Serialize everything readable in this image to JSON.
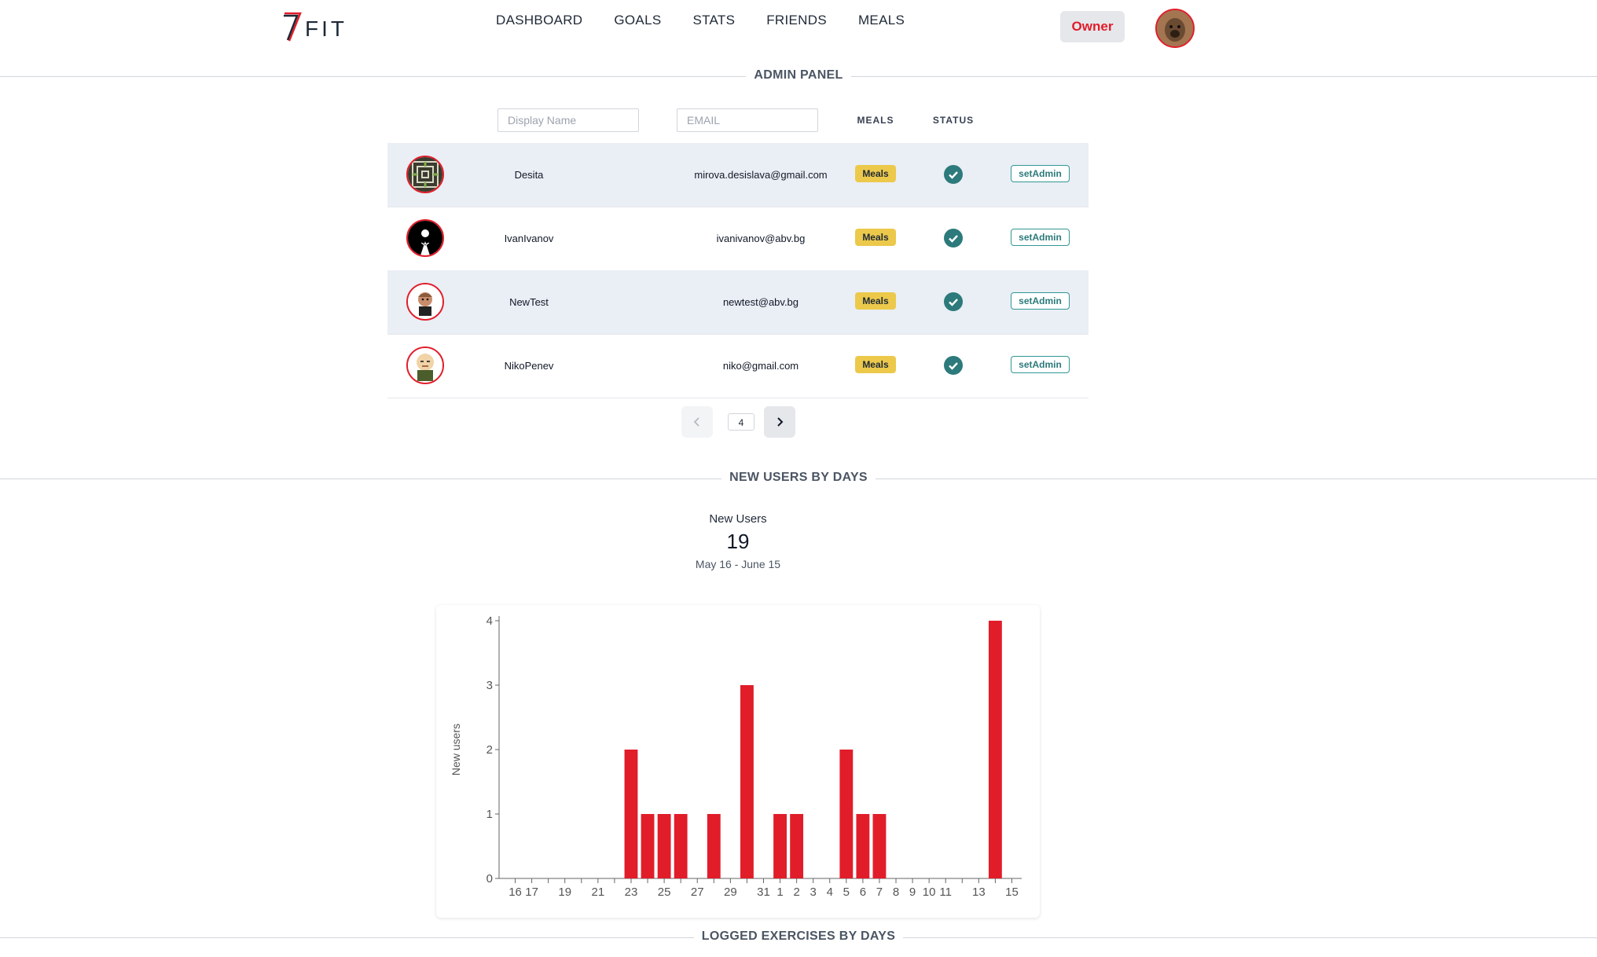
{
  "header": {
    "logo_text": "FIT",
    "nav": [
      "DASHBOARD",
      "GOALS",
      "STATS",
      "FRIENDS",
      "MEALS"
    ],
    "owner_label": "Owner"
  },
  "admin_panel": {
    "title": "ADMIN PANEL",
    "filters": {
      "display_name_placeholder": "Display Name",
      "email_placeholder": "EMAIL"
    },
    "columns": {
      "meals": "MEALS",
      "status": "STATUS"
    },
    "rows": [
      {
        "display_name": "Desita",
        "email": "mirova.desislava@gmail.com",
        "meals_label": "Meals",
        "status": "active",
        "action_label": "setAdmin"
      },
      {
        "display_name": "IvanIvanov",
        "email": "ivanivanov@abv.bg",
        "meals_label": "Meals",
        "status": "active",
        "action_label": "setAdmin"
      },
      {
        "display_name": "NewTest",
        "email": "newtest@abv.bg",
        "meals_label": "Meals",
        "status": "active",
        "action_label": "setAdmin"
      },
      {
        "display_name": "NikoPenev",
        "email": "niko@gmail.com",
        "meals_label": "Meals",
        "status": "active",
        "action_label": "setAdmin"
      }
    ],
    "pagination": {
      "page_count": "4"
    }
  },
  "new_users": {
    "title": "NEW USERS BY DAYS",
    "stat_label": "New Users",
    "stat_value": "19",
    "stat_range": "May 16 - June 15"
  },
  "logged_exercises": {
    "title": "LOGGED EXERCISES BY DAYS"
  },
  "colors": {
    "accent": "#e11d2a",
    "status_teal": "#2c7a7b",
    "badge_yellow": "#ecc94b",
    "row_alt": "#eaeef5"
  },
  "chart_data": {
    "type": "bar",
    "ylabel": "New users",
    "xlabel": "",
    "ylim": [
      0,
      4
    ],
    "yticks": [
      0,
      1,
      2,
      3,
      4
    ],
    "categories": [
      "16",
      "17",
      "18",
      "19",
      "20",
      "21",
      "22",
      "23",
      "24",
      "25",
      "26",
      "27",
      "28",
      "29",
      "30",
      "31",
      "1",
      "2",
      "3",
      "4",
      "5",
      "6",
      "7",
      "8",
      "9",
      "10",
      "11",
      "12",
      "13",
      "14",
      "15"
    ],
    "values": [
      0,
      0,
      0,
      0,
      0,
      0,
      0,
      2,
      1,
      1,
      1,
      0,
      1,
      0,
      3,
      0,
      1,
      1,
      0,
      0,
      2,
      1,
      1,
      0,
      0,
      0,
      0,
      0,
      0,
      4,
      0
    ],
    "tick_labels": [
      "16",
      "17",
      "19",
      "21",
      "23",
      "25",
      "27",
      "29",
      "31",
      "1",
      "2",
      "3",
      "4",
      "5",
      "6",
      "7",
      "8",
      "9",
      "10",
      "11",
      "13",
      "15"
    ],
    "bar_color": "#e11d2a",
    "grid": false
  }
}
